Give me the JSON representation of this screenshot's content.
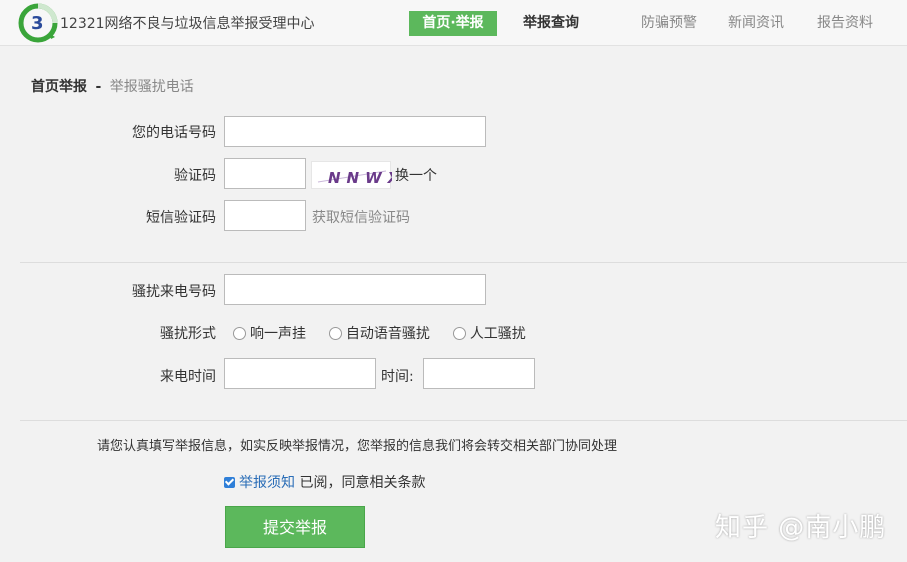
{
  "header": {
    "site_title": "12321网络不良与垃圾信息举报受理中心",
    "nav": {
      "home": "首页·举报",
      "query": "举报查询",
      "fraud": "防骗预警",
      "news": "新闻资讯",
      "report": "报告资料"
    }
  },
  "breadcrumb": {
    "home": "首页举报",
    "sep": "-",
    "current": "举报骚扰电话"
  },
  "form": {
    "phone_label": "您的电话号码",
    "phone_value": "",
    "captcha_label": "验证码",
    "captcha_value": "",
    "captcha_text": "NNWX",
    "captcha_refresh": "换一个",
    "sms_label": "短信验证码",
    "sms_value": "",
    "sms_get": "获取短信验证码",
    "harass_number_label": "骚扰来电号码",
    "harass_number_value": "",
    "harass_type_label": "骚扰形式",
    "harass_types": [
      "响一声挂",
      "自动语音骚扰",
      "人工骚扰"
    ],
    "call_time_label": "来电时间",
    "call_date_value": "",
    "time_label": "时间:",
    "time_value": ""
  },
  "notice": {
    "text": "请您认真填写举报信息，如实反映举报情况，您举报的信息我们将会转交相关部门协同处理",
    "terms_link": "举报须知",
    "terms_text": "已阅，同意相关条款",
    "terms_checked": true
  },
  "submit_label": "提交举报",
  "watermark": "知乎 @南小鹏",
  "colors": {
    "accent": "#5cb85c",
    "link": "#2a6db7"
  }
}
